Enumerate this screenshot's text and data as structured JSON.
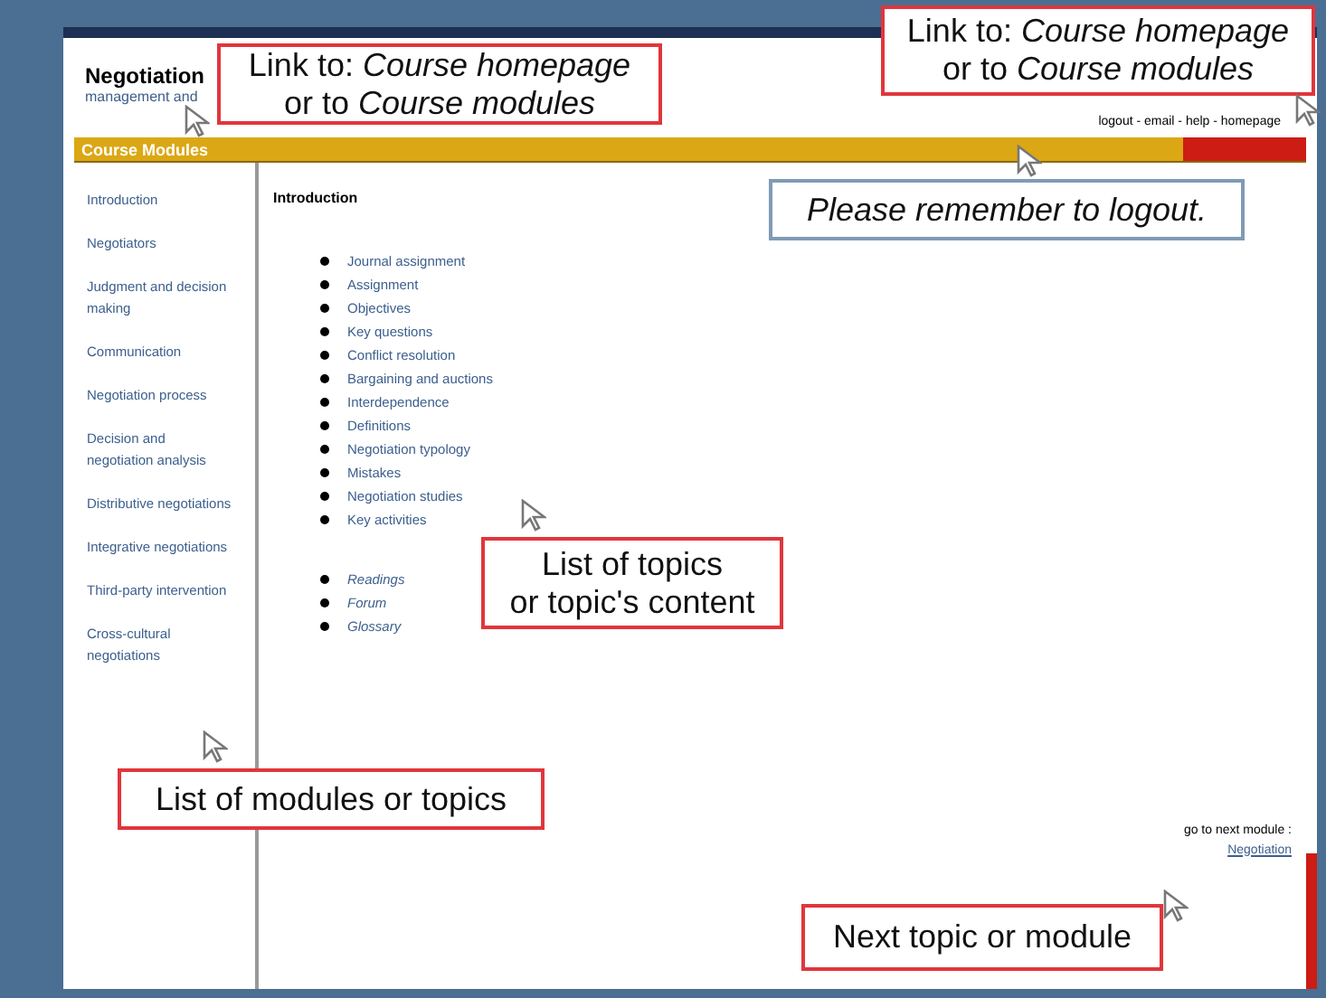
{
  "header": {
    "title": "Negotiation",
    "subtitle": "management and"
  },
  "top_links": "logout - email - help - homepage",
  "bar": {
    "title": "Course Modules"
  },
  "sidebar": {
    "items": [
      {
        "label": "Introduction"
      },
      {
        "label": "Negotiators"
      },
      {
        "label": "Judgment and decision making"
      },
      {
        "label": "Communication"
      },
      {
        "label": "Negotiation process"
      },
      {
        "label": "Decision and negotiation analysis"
      },
      {
        "label": "Distributive negotiations"
      },
      {
        "label": "Integrative negotiations"
      },
      {
        "label": "Third-party intervention"
      },
      {
        "label": "Cross-cultural negotiations"
      }
    ]
  },
  "content": {
    "heading": "Introduction",
    "topics": [
      "Journal assignment",
      "Assignment",
      "Objectives",
      "Key questions",
      "Conflict resolution",
      "Bargaining and auctions",
      "Interdependence",
      "Definitions",
      "Negotiation typology",
      "Mistakes",
      "Negotiation studies",
      "Key activities"
    ],
    "extras": [
      "Readings",
      "Forum",
      "Glossary"
    ]
  },
  "next": {
    "label": "go to next module :",
    "link": "Negotiation"
  },
  "callouts": [
    {
      "kind": "label",
      "lines": [
        "Link to: *Course homepage*",
        "or to *Course modules*"
      ]
    },
    {
      "kind": "label",
      "lines": [
        "Link to: *Course homepage*",
        "or to *Course modules*"
      ]
    },
    {
      "kind": "note",
      "lines": [
        "Please remember to logout."
      ]
    },
    {
      "kind": "label",
      "lines": [
        "List of topics",
        "or topic's content"
      ]
    },
    {
      "kind": "label",
      "lines": [
        "List of modules or topics"
      ]
    },
    {
      "kind": "label",
      "lines": [
        "Next topic or module"
      ]
    }
  ]
}
